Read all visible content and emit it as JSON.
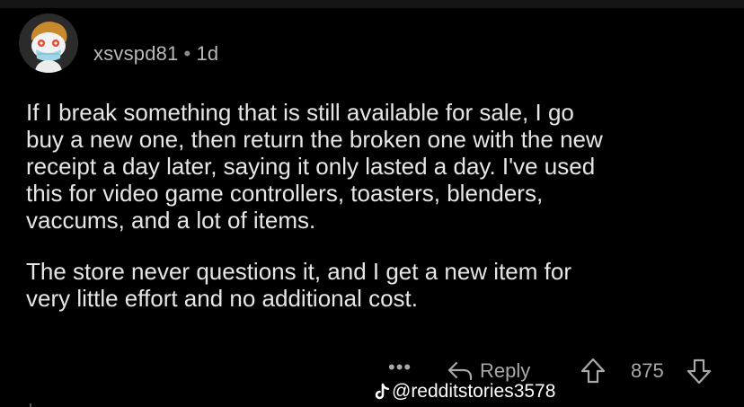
{
  "comment": {
    "author": "xsvspd81",
    "separator": "•",
    "age": "1d",
    "paragraphs": [
      "If I break something that is still available for sale, I go\nbuy a new one, then return the broken one with the new\nreceipt a day later, saying it only lasted a day. I've used\nthis for video game controllers, toasters, blenders,\nvaccums, and a lot of items.",
      "The store never questions it, and I get a new item for\nvery little effort and no additional cost."
    ]
  },
  "actions": {
    "more_label": "•••",
    "reply_label": "Reply",
    "vote_count": "875"
  },
  "watermark": {
    "handle": "@redditstories3578"
  },
  "colors": {
    "background": "#000000",
    "body_text": "#e6e6e6",
    "meta_text": "#b8b8b8",
    "action_gray": "#a9a9a9"
  },
  "icons": {
    "avatar": "snoo-avatar-mask",
    "reply": "reply-arrow-icon",
    "upvote": "upvote-arrow-icon",
    "downvote": "downvote-arrow-icon",
    "watermark_logo": "tiktok-logo-icon"
  }
}
